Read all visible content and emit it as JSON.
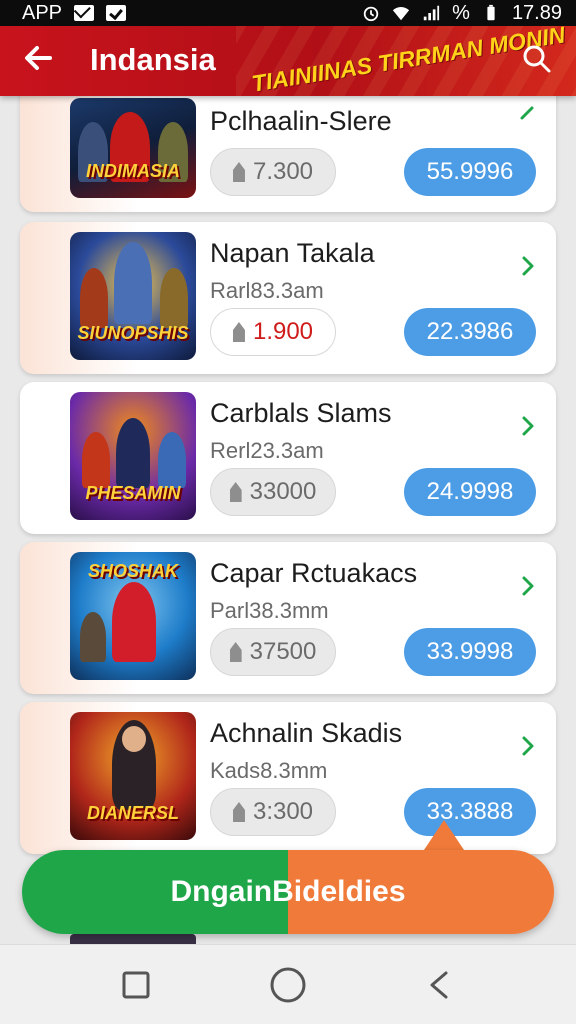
{
  "status_bar": {
    "left_text": "APP",
    "right_text": "% ",
    "time": "17.89"
  },
  "header": {
    "title": "Indansia",
    "banner": "TIAINIINAS TIRRMAN MONIN"
  },
  "items": [
    {
      "name": "Pclhaalin-Slere",
      "sub": "",
      "price_left": "7.300",
      "price_right": "55.9996",
      "art": "INDIMASIA",
      "colors": [
        "#1c3a6b",
        "#c41a1a"
      ]
    },
    {
      "name": "Napan Takala",
      "sub": "Rarl83.3am",
      "price_left": "1.900",
      "price_right": "22.3986",
      "art": "SIUNOPSHIS",
      "colors": [
        "#2b4a9a",
        "#e0a526"
      ]
    },
    {
      "name": "Carblals Slams",
      "sub": "Rerl23.3am",
      "price_left": "33000",
      "price_right": "24.9998",
      "art": "PHESAMIN",
      "colors": [
        "#6b2aa8",
        "#f08a1c"
      ]
    },
    {
      "name": "Capar Rctuakacs",
      "sub": "Parl38.3mm",
      "price_left": "37500",
      "price_right": "33.9998",
      "art": "SHOSHAK",
      "colors": [
        "#1e7cc9",
        "#d21d2a"
      ]
    },
    {
      "name": "Achnalin Skadis",
      "sub": "Kads8.3mm",
      "price_left": "3:300",
      "price_right": "33.3888",
      "art": "DIANERSL",
      "colors": [
        "#b0261a",
        "#f3a72a"
      ]
    }
  ],
  "cta": {
    "label": "DngainBideldies"
  }
}
